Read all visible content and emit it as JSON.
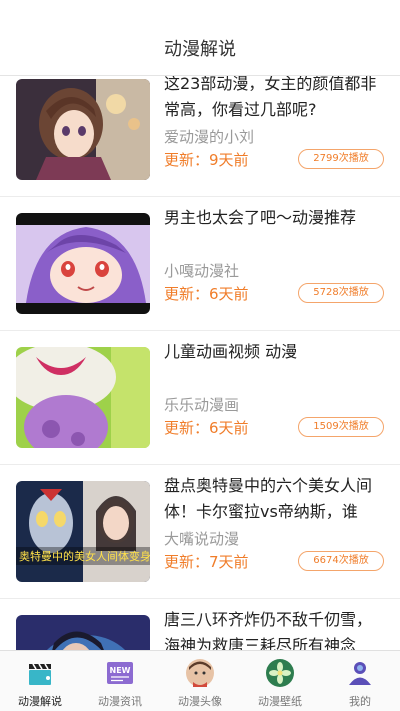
{
  "header": {
    "title": "动漫解说"
  },
  "items": [
    {
      "title": "这23部动漫，女主的颜值都非常高，你看过几部呢?",
      "author": "爱动漫的小刘",
      "updated": "更新：9天前",
      "plays": "2799次播放"
    },
    {
      "title": "男主也太会了吧～动漫推荐",
      "author": "小嘎动漫社",
      "updated": "更新：6天前",
      "plays": "5728次播放"
    },
    {
      "title": "儿童动画视频 动漫",
      "author": "乐乐动漫画",
      "updated": "更新：6天前",
      "plays": "1509次播放"
    },
    {
      "title": "盘点奥特曼中的六个美女人间体！卡尔蜜拉vs帝纳斯，谁最...",
      "author": "大嘴说动漫",
      "updated": "更新：7天前",
      "plays": "6674次播放",
      "thumb_caption": "奥特曼中的美女人间体变身"
    },
    {
      "title": "唐三八环齐炸仍不敌千仞雪，海神为救唐三耗尽所有神念",
      "author": "",
      "updated": "",
      "plays": ""
    }
  ],
  "tabs": [
    {
      "label": "动漫解说",
      "icon": "clapperboard-icon",
      "active": true
    },
    {
      "label": "动漫资讯",
      "icon": "new-badge-icon",
      "badge": "NEW",
      "active": false
    },
    {
      "label": "动漫头像",
      "icon": "avatar-face-icon",
      "active": false
    },
    {
      "label": "动漫壁纸",
      "icon": "flower-wallpaper-icon",
      "active": false
    },
    {
      "label": "我的",
      "icon": "user-icon",
      "active": false
    }
  ],
  "colors": {
    "accent": "#f07d2a",
    "badge_border": "#f4a56b",
    "author": "#9a9a9a",
    "tab_purple": "#8c6bd1",
    "tab_green": "#2e7d4f"
  }
}
